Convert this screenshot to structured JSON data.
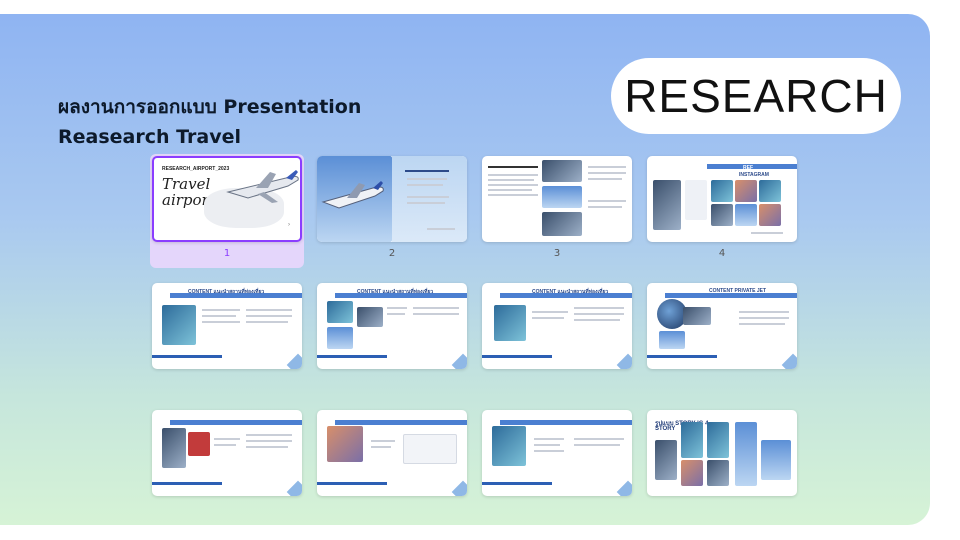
{
  "heading": {
    "line1": "ผลงานการออกแบบ Presentation",
    "line2": "Reasearch Travel"
  },
  "badge": "RESEARCH",
  "slides": [
    {
      "number": "1",
      "selected": true
    },
    {
      "number": "2",
      "selected": false
    },
    {
      "number": "3",
      "selected": false
    },
    {
      "number": "4",
      "selected": false
    }
  ],
  "slide1": {
    "small_title": "RESEARCH_AIRPORT_2023",
    "script_line1": "Travel",
    "script_line2": "airport"
  },
  "slide4": {
    "title": "REF",
    "title2": "INSTAGRAM"
  },
  "slide5": {
    "title": "CONTENT แนะนำสถานที่ท่องเที่ยว"
  },
  "slide6": {
    "title": "CONTENT แนะนำสถานที่ท่องเที่ยว"
  },
  "slide7": {
    "title": "CONTENT แนะนำสถานที่ท่องเที่ยว"
  },
  "slide8": {
    "title": "CONTENT PRIVATE JET"
  },
  "slide12": {
    "title_line1": "รูปแบบ STORY IG 4",
    "title_line2": "STORY"
  },
  "colors": {
    "accent": "#8b3dff",
    "selected_bg": "#e4d6fb",
    "bar_blue": "#4b7fd1"
  }
}
